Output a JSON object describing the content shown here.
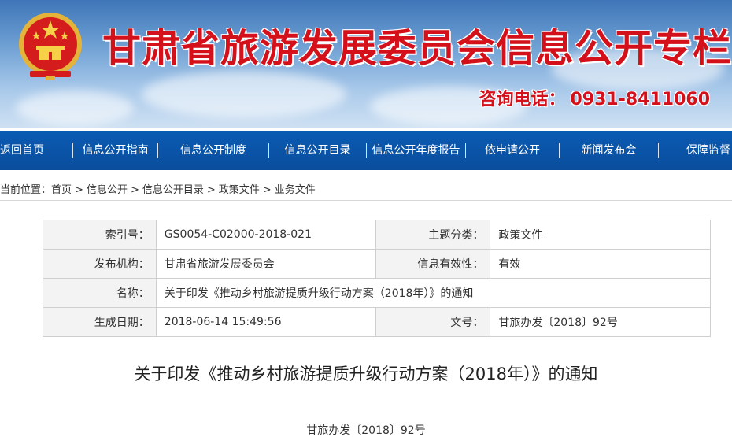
{
  "header": {
    "site_title": "甘肃省旅游发展委员会信息公开专栏",
    "hotline_label": "咨询电话：",
    "hotline_number": "0931-8411060",
    "colors": {
      "title_red": "#d4111b",
      "nav_blue": "#0a4d9c"
    },
    "emblem_icon": "national-emblem-icon"
  },
  "nav": {
    "items": [
      {
        "label": "返回首页"
      },
      {
        "label": "信息公开指南"
      },
      {
        "label": "信息公开制度"
      },
      {
        "label": "信息公开目录"
      },
      {
        "label": "信息公开年度报告"
      },
      {
        "label": "依申请公开"
      },
      {
        "label": "新闻发布会"
      },
      {
        "label": "保障监督"
      }
    ]
  },
  "breadcrumb": {
    "prefix": "当前位置：",
    "items": [
      "首页",
      "信息公开",
      "信息公开目录",
      "政策文件",
      "业务文件"
    ],
    "separator": ">"
  },
  "info": {
    "index_label": "索引号：",
    "index_value": "GS0054-C02000-2018-021",
    "topic_label": "主题分类：",
    "topic_value": "政策文件",
    "publisher_label": "发布机构：",
    "publisher_value": "甘肃省旅游发展委员会",
    "validity_label": "信息有效性：",
    "validity_value": "有效",
    "name_label": "名称：",
    "name_value": "关于印发《推动乡村旅游提质升级行动方案（2018年）》的通知",
    "date_label": "生成日期：",
    "date_value": "2018-06-14 15:49:56",
    "docno_label": "文号：",
    "docno_value": "甘旅办发〔2018〕92号"
  },
  "document": {
    "title": "关于印发《推动乡村旅游提质升级行动方案（2018年）》的通知",
    "number": "甘旅办发〔2018〕92号"
  }
}
